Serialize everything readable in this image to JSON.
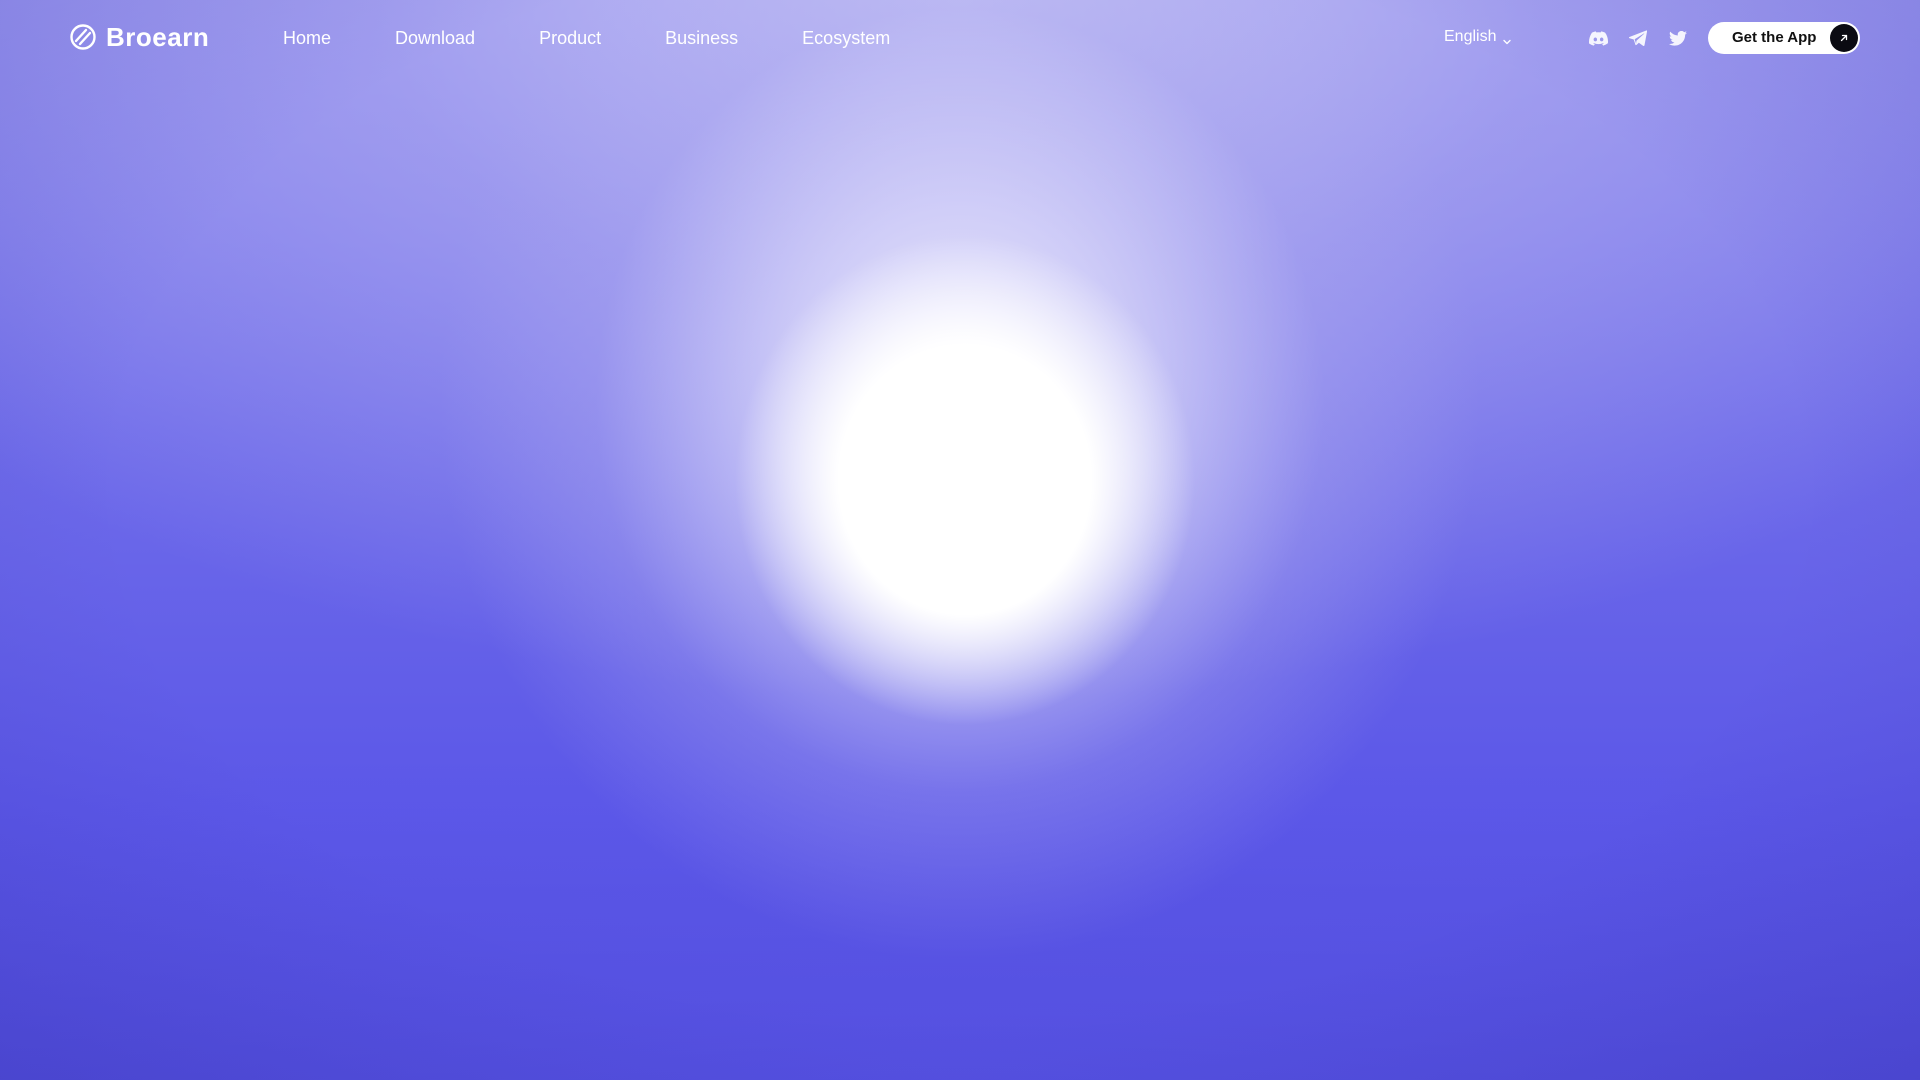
{
  "brand": {
    "name": "Broearn",
    "logo_icon": "broearn-logo-icon"
  },
  "nav": {
    "items": [
      {
        "label": "Home"
      },
      {
        "label": "Download"
      },
      {
        "label": "Product"
      },
      {
        "label": "Business"
      },
      {
        "label": "Ecosystem"
      }
    ]
  },
  "language": {
    "selected": "English",
    "icon": "chevron-down-icon"
  },
  "socials": [
    {
      "icon": "discord-icon"
    },
    {
      "icon": "telegram-icon"
    },
    {
      "icon": "twitter-icon"
    }
  ],
  "cta": {
    "label": "Get the App",
    "icon": "arrow-up-right-icon"
  },
  "colors": {
    "background": "#5a57e6",
    "glow": "#ffffff",
    "cta_bg": "#ffffff",
    "cta_arrow_bg": "#0b0b12",
    "text": "#ffffff"
  }
}
